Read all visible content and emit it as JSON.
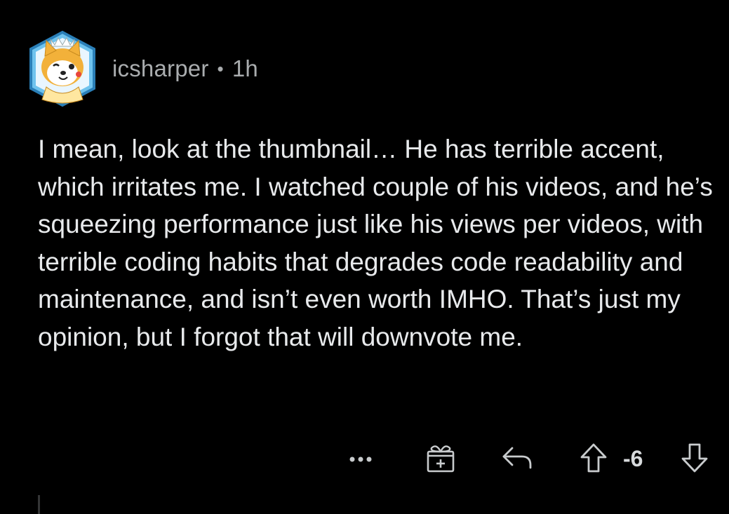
{
  "comment": {
    "username": "icsharper",
    "separator": "•",
    "time": "1h",
    "body": "I mean, look at the thumbnail… He has terrible accent, which irritates me. I watched couple of his videos, and he’s squeezing performance just like his views per videos, with terrible coding habits that degrades code readability and maintenance, and isn’t even worth IMHO. That’s just my opinion, but I forgot that will downvote me.",
    "score": "-6"
  },
  "icons": {
    "avatar": "shiba-avatar-icon",
    "more": "more-dots-icon",
    "award": "award-gift-icon",
    "reply": "reply-arrow-icon",
    "upvote": "upvote-arrow-icon",
    "downvote": "downvote-arrow-icon"
  },
  "colors": {
    "background": "#000000",
    "text": "#e8eaec",
    "meta": "#a9acae",
    "avatar_ring": "#5fb3e0"
  }
}
